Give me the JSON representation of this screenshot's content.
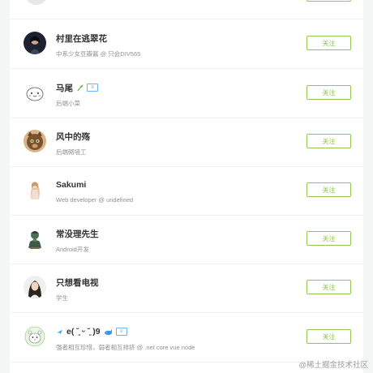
{
  "follow_label": "关注",
  "users": [
    {
      "name": "村里在逃翠花",
      "badges": [],
      "desc": "中系少女豆瓣酱 @ 只会DIV565",
      "avatar": "dark-portrait-avatar"
    },
    {
      "name": "马尾",
      "badges": [
        "sprout-icon",
        "level-badge"
      ],
      "desc": "后端小菜",
      "avatar": "cartoon-cat-avatar"
    },
    {
      "name": "风中的殇",
      "badges": [],
      "desc": "后端砌墙工",
      "avatar": "brown-cat-avatar"
    },
    {
      "name": "Sakumi",
      "badges": [],
      "desc": "Web developer @ undefined",
      "avatar": "anime-girl-avatar"
    },
    {
      "name": "常没理先生",
      "badges": [],
      "desc": "Android开发",
      "avatar": "statue-avatar"
    },
    {
      "name": "只想看电视",
      "badges": [],
      "desc": "学生",
      "avatar": "girl-photo-avatar"
    },
    {
      "name": "e( ˘͈ ᵕ ˘͈ )9",
      "badges": [
        "plane-icon",
        "whale-icon",
        "level-badge"
      ],
      "desc": "强者相互珍惜，弱者相互排挤 @ .net core vue node",
      "avatar": "cartoon-animal-avatar"
    }
  ],
  "watermark": "@稀土掘金技术社区"
}
